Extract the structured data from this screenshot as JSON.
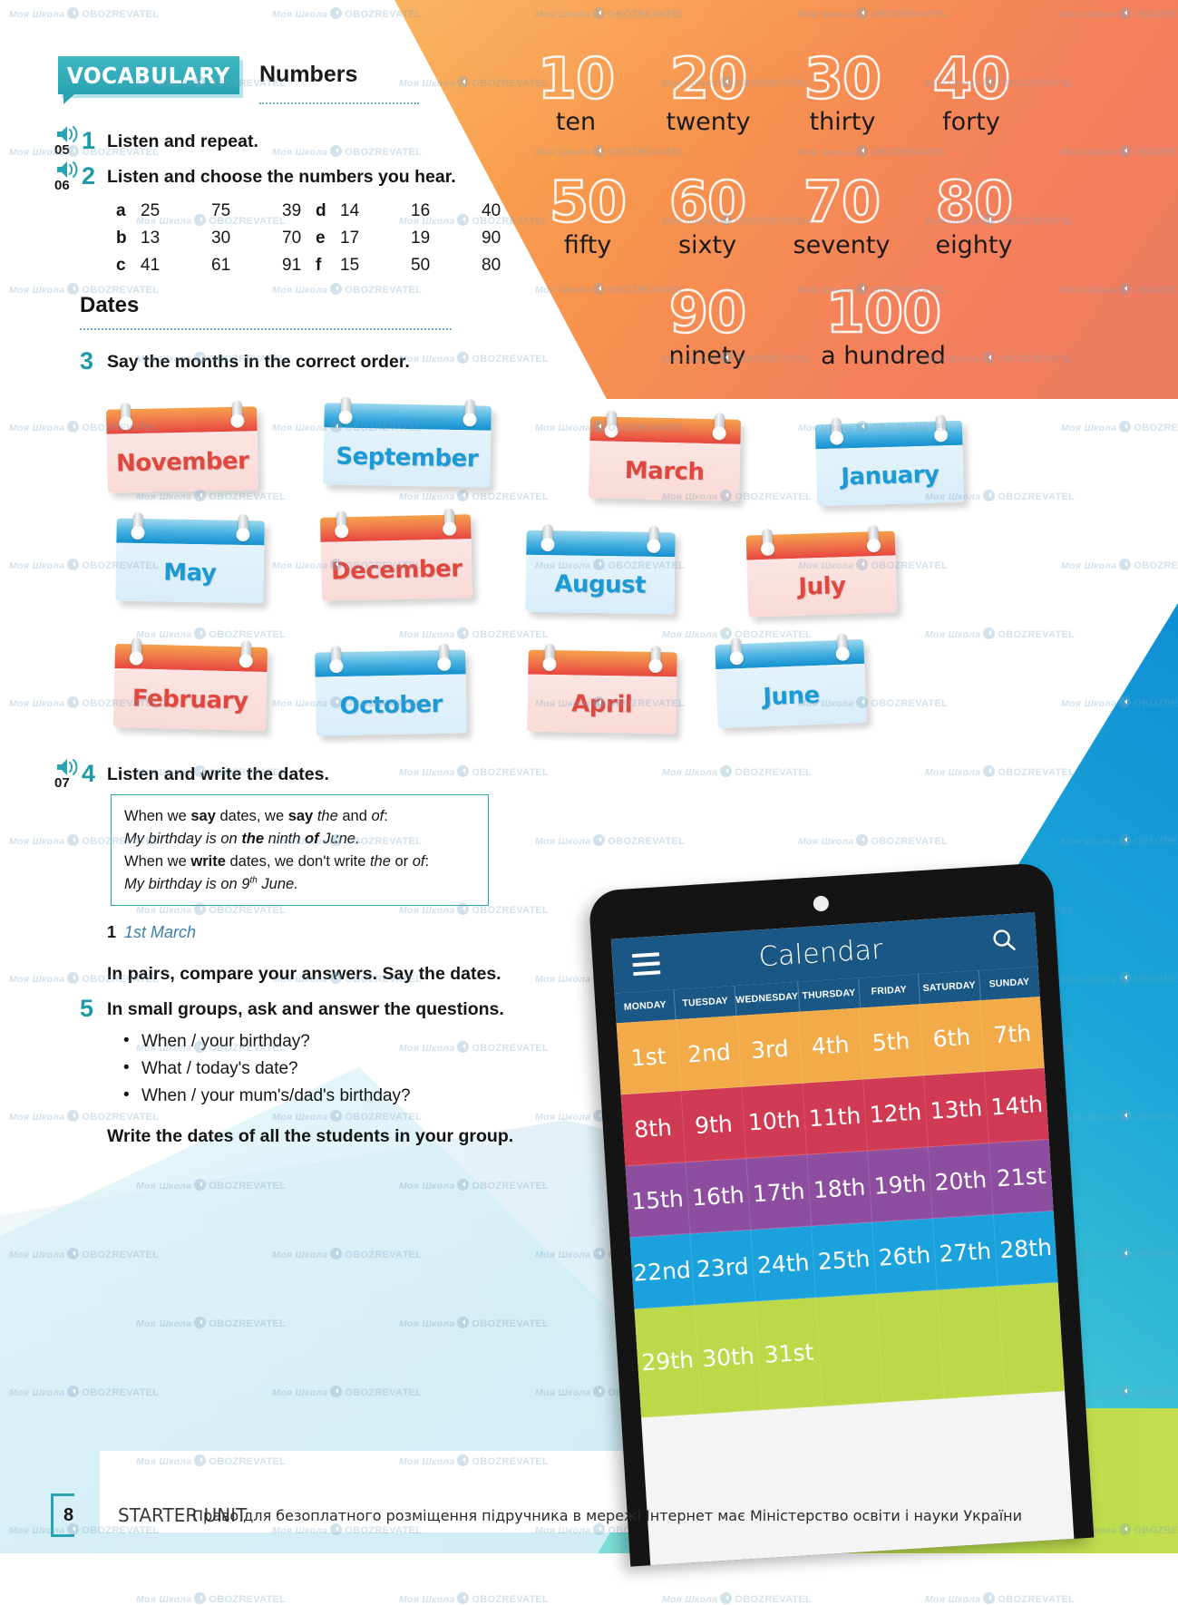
{
  "header": {
    "badge": "VOCABULARY",
    "section_title": "Numbers"
  },
  "exercises": [
    {
      "num": "1",
      "audio": "05",
      "text": "Listen and repeat."
    },
    {
      "num": "2",
      "audio": "06",
      "text": "Listen and choose the numbers you hear."
    },
    {
      "num": "3",
      "audio": "",
      "text": "Say the months in the correct order."
    },
    {
      "num": "4",
      "audio": "07",
      "text": "Listen and write the dates."
    },
    {
      "num": "5",
      "audio": "",
      "text": "In small groups, ask and answer the questions."
    }
  ],
  "number_choices": {
    "left": [
      {
        "label": "a",
        "values": [
          "25",
          "75",
          "39"
        ]
      },
      {
        "label": "b",
        "values": [
          "13",
          "30",
          "70"
        ]
      },
      {
        "label": "c",
        "values": [
          "41",
          "61",
          "91"
        ]
      }
    ],
    "right": [
      {
        "label": "d",
        "values": [
          "14",
          "16",
          "40"
        ]
      },
      {
        "label": "e",
        "values": [
          "17",
          "19",
          "90"
        ]
      },
      {
        "label": "f",
        "values": [
          "15",
          "50",
          "80"
        ]
      }
    ]
  },
  "dates_heading": "Dates",
  "numbers_poster": [
    {
      "digit": "10",
      "word": "ten"
    },
    {
      "digit": "20",
      "word": "twenty"
    },
    {
      "digit": "30",
      "word": "thirty"
    },
    {
      "digit": "40",
      "word": "forty"
    },
    {
      "digit": "50",
      "word": "fifty"
    },
    {
      "digit": "60",
      "word": "sixty"
    },
    {
      "digit": "70",
      "word": "seventy"
    },
    {
      "digit": "80",
      "word": "eighty"
    },
    {
      "digit": "90",
      "word": "ninety"
    },
    {
      "digit": "100",
      "word": "a hundred"
    }
  ],
  "month_cards": [
    {
      "name": "November",
      "color": "red"
    },
    {
      "name": "September",
      "color": "blue"
    },
    {
      "name": "March",
      "color": "red"
    },
    {
      "name": "January",
      "color": "blue"
    },
    {
      "name": "May",
      "color": "blue"
    },
    {
      "name": "December",
      "color": "red"
    },
    {
      "name": "August",
      "color": "blue"
    },
    {
      "name": "July",
      "color": "red"
    },
    {
      "name": "February",
      "color": "red"
    },
    {
      "name": "October",
      "color": "blue"
    },
    {
      "name": "April",
      "color": "red"
    },
    {
      "name": "June",
      "color": "blue"
    }
  ],
  "grammar_box": {
    "line1_a": "When we ",
    "line1_say": "say",
    "line1_b": " dates, we ",
    "line1_say2": "say",
    "line1_c": " ",
    "line1_the": "the",
    "line1_d": " and ",
    "line1_of": "of",
    "line1_e": ":",
    "line2_a": "My birthday is on ",
    "line2_the": "the",
    "line2_b": " ninth ",
    "line2_of": "of",
    "line2_c": " June.",
    "line3_a": "When we ",
    "line3_write": "write",
    "line3_b": " dates, we don't write ",
    "line3_the": "the",
    "line3_c": " or ",
    "line3_of": "of",
    "line3_d": ":",
    "line4_a": "My birthday is on 9",
    "line4_sup": "th",
    "line4_b": " June."
  },
  "answer_example": {
    "num": "1",
    "value": "1st March"
  },
  "pairs_instruction": "In pairs, compare your answers. Say the dates.",
  "questions": [
    "When / your birthday?",
    "What / today's date?",
    "When / your mum's/dad's birthday?"
  ],
  "closing_instruction": "Write the dates of all the students in your group.",
  "tablet": {
    "app_title": "Calendar",
    "weekdays": [
      "MONDAY",
      "TUESDAY",
      "WEDNESDAY",
      "THURSDAY",
      "FRIDAY",
      "SATURDAY",
      "SUNDAY"
    ],
    "rows": [
      {
        "color": "#f2ab48",
        "days": [
          "1st",
          "2nd",
          "3rd",
          "4th",
          "5th",
          "6th",
          "7th"
        ]
      },
      {
        "color": "#d03a52",
        "days": [
          "8th",
          "9th",
          "10th",
          "11th",
          "12th",
          "13th",
          "14th"
        ]
      },
      {
        "color": "#8e4ea0",
        "days": [
          "15th",
          "16th",
          "17th",
          "18th",
          "19th",
          "20th",
          "21st"
        ]
      },
      {
        "color": "#1ba2dd",
        "days": [
          "22nd",
          "23rd",
          "24th",
          "25th",
          "26th",
          "27th",
          "28th"
        ]
      },
      {
        "color": "#bcd94a",
        "days": [
          "29th",
          "30th",
          "31st",
          "",
          "",
          "",
          ""
        ]
      }
    ]
  },
  "footer": {
    "page_number": "8",
    "unit_name": "STARTER UNIT",
    "ministry_note": "Право для безоплатного розміщення підручника в мережі Інтернет має Міністерство освіти і науки України"
  },
  "watermark": {
    "brand_a": "Моя Школа",
    "brand_b": "OBOZREVATEL"
  },
  "colors": {
    "accent_teal": "#2aa4b2",
    "card_red": "#e0483f",
    "card_blue": "#1b9ad6",
    "tablet_header": "#1a5785"
  }
}
